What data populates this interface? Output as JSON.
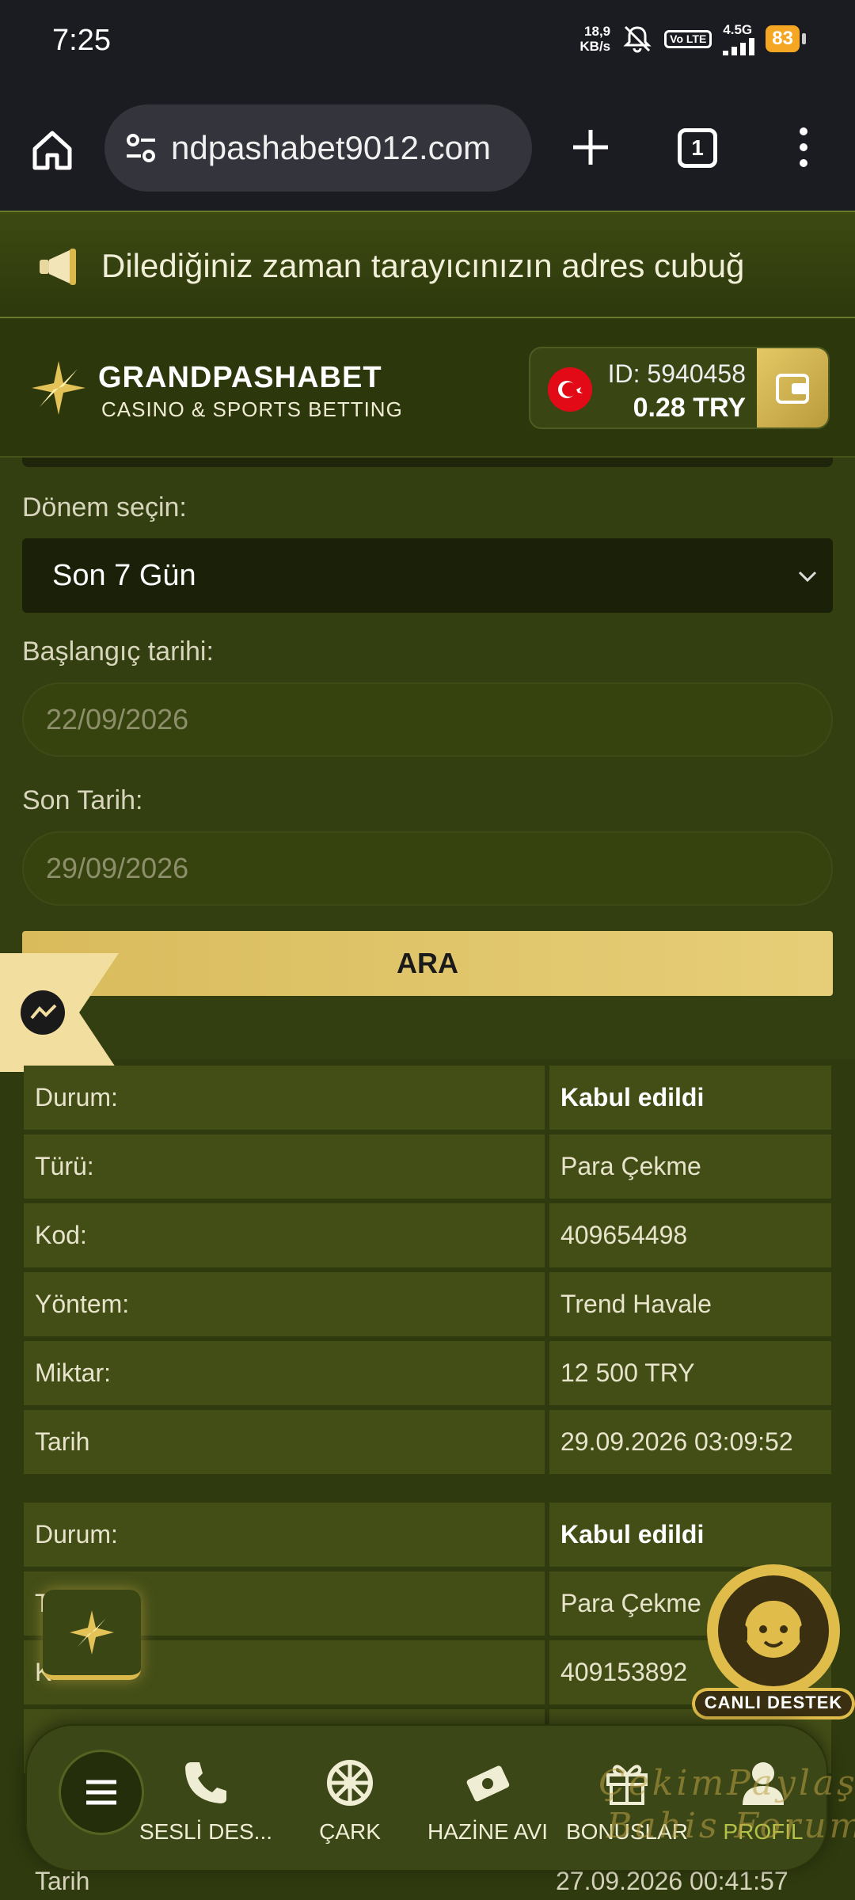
{
  "status_bar": {
    "time": "7:25",
    "net_speed_value": "18,9",
    "net_speed_unit": "KB/s",
    "volte": "Vo LTE",
    "network": "4.5G",
    "battery": "83"
  },
  "browser": {
    "url": "ndpashabet9012.com",
    "tab_count": "1"
  },
  "announcement": {
    "text": "Dilediğiniz zaman tarayıcınızın adres cubuğ"
  },
  "header": {
    "brand_name": "GRANDPASHABET",
    "brand_sub": "CASINO & SPORTS BETTING",
    "user_id": "ID: 5940458",
    "balance": "0.28  TRY"
  },
  "form": {
    "period_label": "Dönem seçin:",
    "period_value": "Son 7 Gün",
    "start_label": "Başlangıç tarihi:",
    "start_value": "22/09/2026",
    "end_label": "Son Tarih:",
    "end_value": "29/09/2026",
    "search_button": "ARA"
  },
  "transactions": [
    {
      "rows": [
        {
          "label": "Durum:",
          "value": "Kabul edildi",
          "bold": true
        },
        {
          "label": "Türü:",
          "value": "Para Çekme"
        },
        {
          "label": "Kod:",
          "value": "409654498"
        },
        {
          "label": "Yöntem:",
          "value": "Trend Havale"
        },
        {
          "label": "Miktar:",
          "value": "12 500 TRY"
        },
        {
          "label": "Tarih",
          "value": "29.09.2026 03:09:52"
        }
      ]
    },
    {
      "rows": [
        {
          "label": "Durum:",
          "value": "Kabul edildi",
          "bold": true
        },
        {
          "label": "T",
          "value": "Para Çekme"
        },
        {
          "label": "K",
          "value": "409153892"
        }
      ]
    }
  ],
  "peek_row": {
    "label": "Tarih",
    "value": "27.09.2026 00:41:57"
  },
  "live_support": {
    "label": "CANLI DESTEK"
  },
  "bottom_nav": {
    "items": [
      {
        "label": "SESLİ DES...",
        "icon": "phone-icon"
      },
      {
        "label": "ÇARK",
        "icon": "wheel-icon"
      },
      {
        "label": "HAZİNE AVI",
        "icon": "treasure-icon"
      },
      {
        "label": "BONUSLAR",
        "icon": "gift-icon"
      },
      {
        "label": "PROFİL",
        "icon": "user-icon"
      }
    ]
  },
  "watermark": {
    "line1": "ÇekimPaylaş",
    "line2": "Bahis Forum"
  },
  "colors": {
    "background": "#2f3a0f",
    "accent_gold": "#d9bb5c",
    "active_nav": "#b5c24a",
    "cell_bg": "#434e17"
  }
}
